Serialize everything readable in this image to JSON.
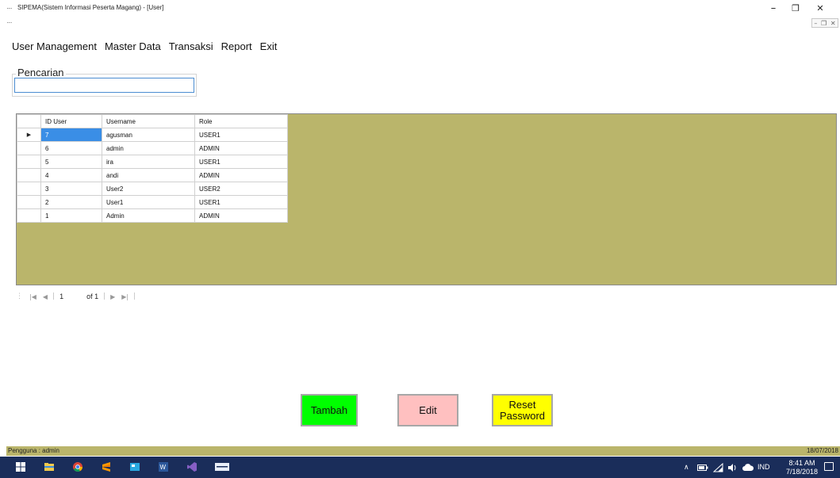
{
  "window": {
    "title": "SIPEMA(Sistem Informasi Peserta Magang) - [User]",
    "minimize": "–",
    "maximize": "❐",
    "close": "✕",
    "mdi_controls": [
      "–",
      "❐",
      "✕"
    ]
  },
  "menu": [
    "User Management",
    "Master Data",
    "Transaksi",
    "Report",
    "Exit"
  ],
  "search": {
    "group_label": "Pencarian",
    "value": ""
  },
  "grid": {
    "columns": [
      "ID User",
      "Username",
      "Role"
    ],
    "rows": [
      [
        "7",
        "agusman",
        "USER1"
      ],
      [
        "6",
        "admin",
        "ADMIN"
      ],
      [
        "5",
        "ira",
        "USER1"
      ],
      [
        "4",
        "andi",
        "ADMIN"
      ],
      [
        "3",
        "User2",
        "USER2"
      ],
      [
        "2",
        "User1",
        "USER1"
      ],
      [
        "1",
        "Admin",
        "ADMIN"
      ]
    ],
    "current_row_marker": "▶",
    "selected_row": 0,
    "background_color": "#bab56b"
  },
  "navigator": {
    "position": "1",
    "of_label": "of 1"
  },
  "buttons": {
    "add": "Tambah",
    "edit": "Edit",
    "reset_line1": "Reset",
    "reset_line2": "Password",
    "add_color": "#00ff00",
    "edit_color": "#ffc0c0",
    "reset_color": "#ffff00"
  },
  "status": {
    "user": "Pengguna : admin",
    "date": "18/07/2018"
  },
  "taskbar": {
    "language": "IND",
    "time": "8:41 AM",
    "date": "7/18/2018",
    "icons": [
      "windows-start-icon",
      "file-explorer-icon",
      "chrome-icon",
      "sublime-icon",
      "app-icon",
      "word-icon",
      "visual-studio-icon",
      "sipema-app-icon"
    ]
  }
}
